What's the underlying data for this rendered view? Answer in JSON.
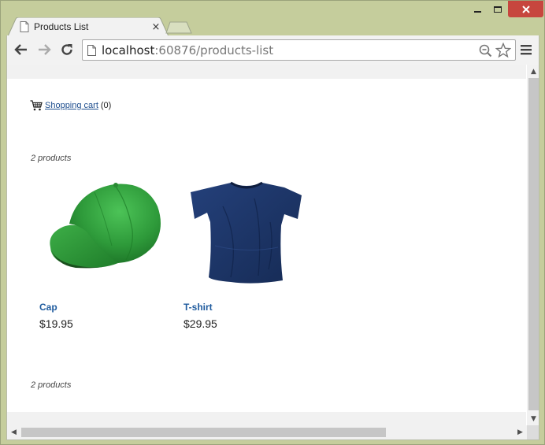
{
  "window": {
    "tab_title": "Products List",
    "tab_close": "×"
  },
  "toolbar": {
    "url_host": "localhost",
    "url_path": ":60876/products-list"
  },
  "page": {
    "cart_link": "Shopping cart",
    "cart_count": "(0)",
    "product_count_top": "2 products",
    "product_count_bottom": "2 products",
    "products": [
      {
        "name": "Cap",
        "price": "$19.95",
        "image": "green-cap"
      },
      {
        "name": "T-shirt",
        "price": "$29.95",
        "image": "navy-tshirt"
      }
    ]
  },
  "colors": {
    "frame": "#c5cd9c",
    "close_button": "#c7463e",
    "link": "#1f5b9e",
    "cap_green": "#2e9a3a",
    "shirt_navy": "#1d3565"
  }
}
